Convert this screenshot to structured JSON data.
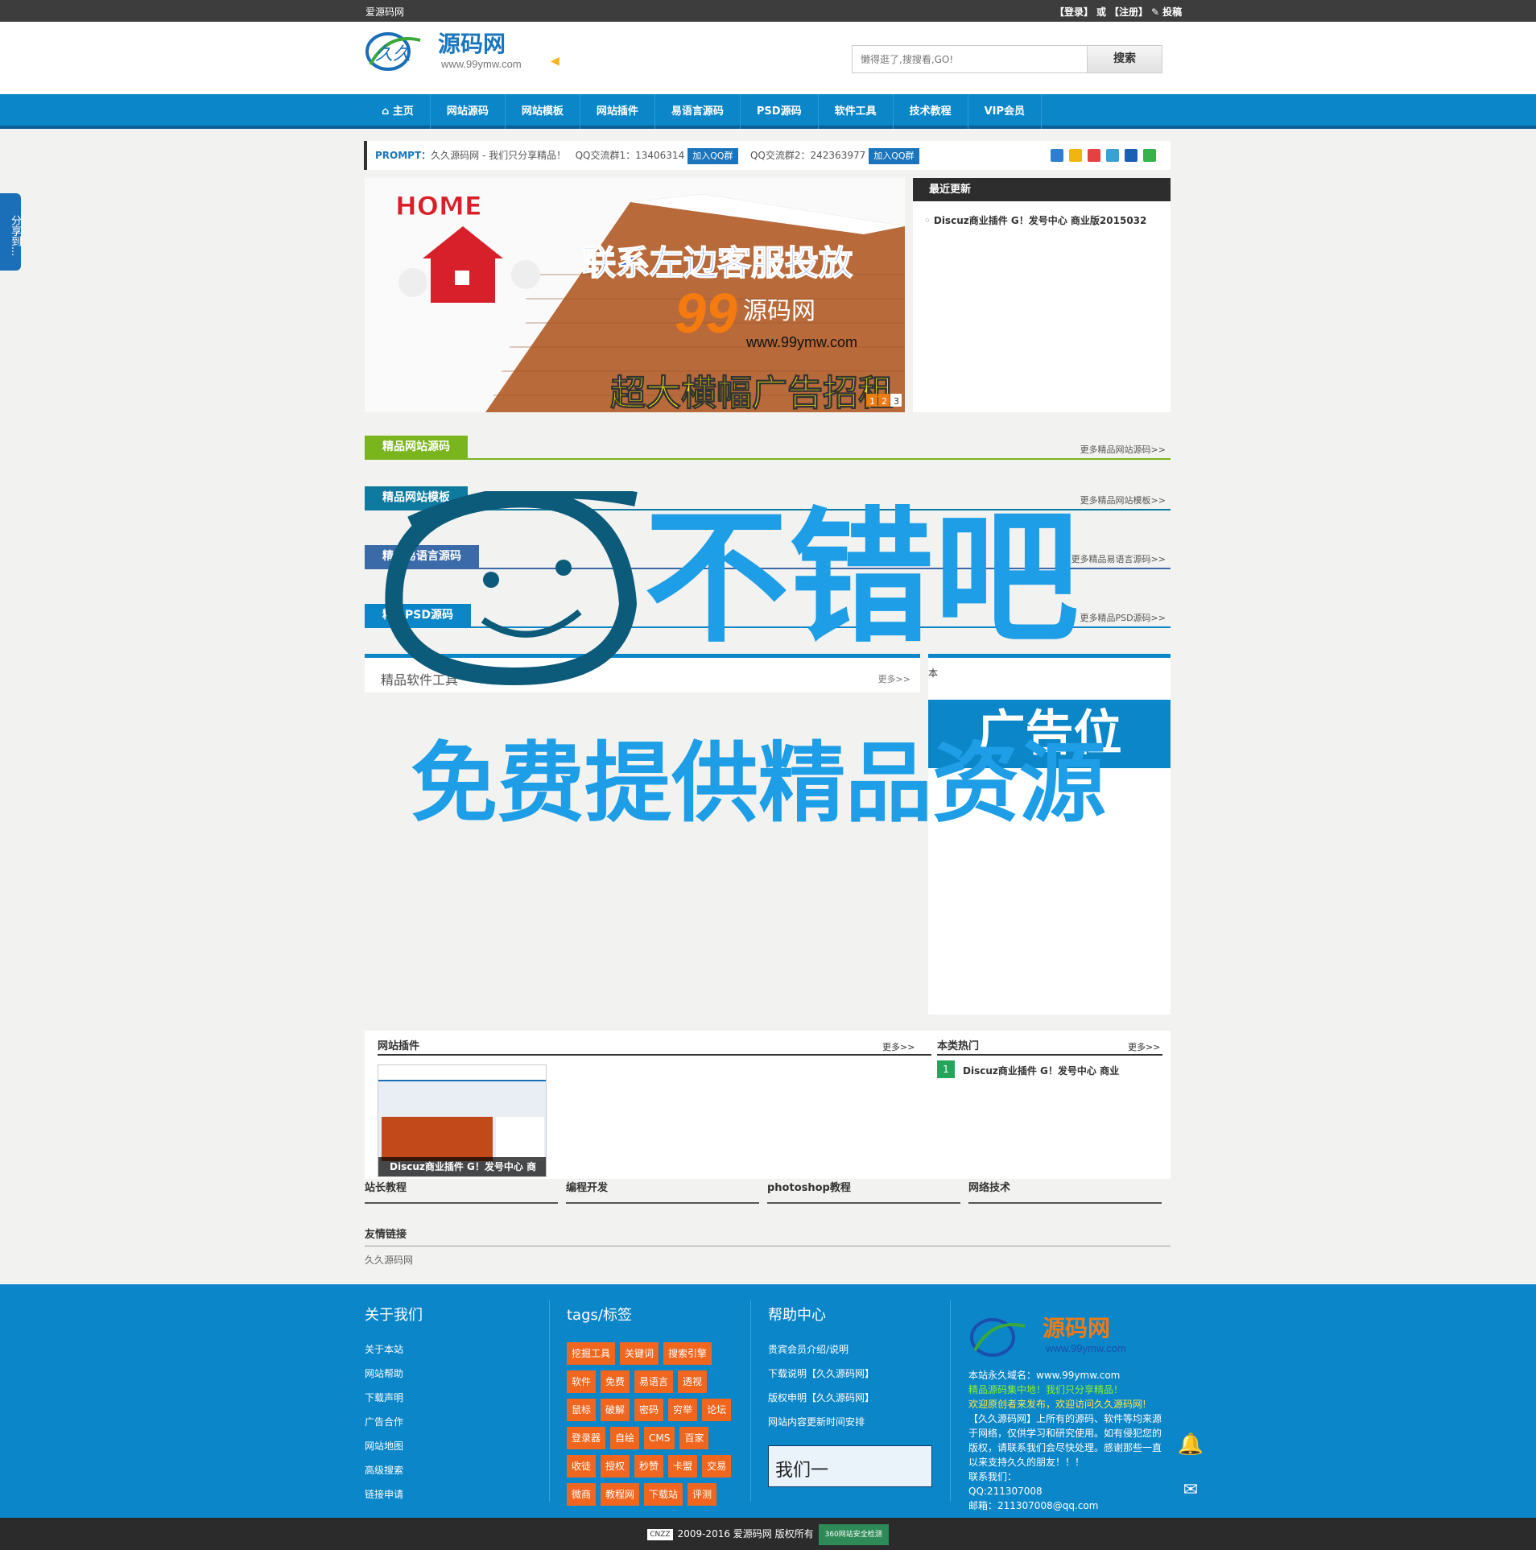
{
  "colors": {
    "brand_blue": "#0b86c8",
    "nav_dark": "#0a5f95",
    "top_bar": "#3d3d3d",
    "green": "#7ab51d",
    "teal": "#0e7aa0",
    "tag_orange": "#f0661e"
  },
  "topbar": {
    "site": "爱源码网",
    "login": "【登录】",
    "or": "或",
    "register": "【注册】",
    "submit": "投稿"
  },
  "logo": {
    "brand": "源码网",
    "prefix": "久久",
    "url": "www.99ymw.com"
  },
  "search": {
    "placeholder": "懒得逛了,搜搜看,GO!",
    "button": "搜索"
  },
  "nav": [
    "⌂ 主页",
    "网站源码",
    "网站模板",
    "网站插件",
    "易语言源码",
    "PSD源码",
    "软件工具",
    "技术教程",
    "VIP会员"
  ],
  "prompt": {
    "label": "PROMPT：",
    "text": "久久源码网 - 我们只分享精品！",
    "qq1_label": "QQ交流群1：",
    "qq1": "13406314",
    "qq2_label": "QQ交流群2：",
    "qq2": "242363977",
    "join": "加入QQ群"
  },
  "side_share": "分享到...",
  "banner": {
    "home": "HOME",
    "line1": "联系左边客服投放",
    "num": "99",
    "brand": "源码网",
    "url": "www.99ymw.com",
    "line2": "超大横幅广告招租",
    "pages": [
      "1",
      "2",
      "3"
    ]
  },
  "recent": {
    "title": "最近更新",
    "items": [
      "Discuz商业插件 G！发号中心 商业版2015032"
    ]
  },
  "sections": [
    {
      "title": "精品网站源码",
      "more": "更多精品网站源码>>"
    },
    {
      "title": "精品网站模板",
      "more": "更多精品网站模板>>"
    },
    {
      "title": "精品易语言源码",
      "more": "更多精品易语言源码>>"
    },
    {
      "title": "精品PSD源码",
      "more": "更多精品PSD源码>>"
    }
  ],
  "software": {
    "title": "精品软件工具",
    "more": "更多>>"
  },
  "adpanel": {
    "title": "本",
    "ad": "广告位"
  },
  "plugins": {
    "title": "网站插件",
    "more": "更多>>",
    "thumb_caption": "Discuz商业插件 G！发号中心 商"
  },
  "hot": {
    "title": "本类热门",
    "more": "更多>>",
    "items": [
      {
        "rank": "1",
        "text": "Discuz商业插件 G！发号中心 商业"
      }
    ]
  },
  "categories": [
    "站长教程",
    "编程开发",
    "photoshop教程",
    "网络技术"
  ],
  "friend": {
    "title": "友情链接",
    "links": [
      "久久源码网"
    ]
  },
  "footer": {
    "about": {
      "title": "关于我们",
      "items": [
        "关于本站",
        "网站帮助",
        "下载声明",
        "广告合作",
        "网站地图",
        "高级搜索",
        "链接申请"
      ]
    },
    "tags": {
      "title": "tags/标签",
      "items": [
        "挖掘工具",
        "关键词",
        "搜索引擎",
        "软件",
        "免费",
        "易语言",
        "透视",
        "鼠标",
        "破解",
        "密码",
        "穷举",
        "论坛",
        "登录器",
        "自绘",
        "CMS",
        "百家",
        "收徒",
        "授权",
        "秒赞",
        "卡盟",
        "交易",
        "微商",
        "教程网",
        "下载站",
        "评测"
      ]
    },
    "help": {
      "title": "帮助中心",
      "items": [
        "贵宾会员介绍/说明",
        "下载说明【久久源码网】",
        "版权申明【久久源码网】",
        "网站内容更新时间安排"
      ],
      "box": "我们一"
    },
    "info": {
      "domain": "本站永久域名：www.99ymw.com",
      "slogan1": "精品源码集中地！我们只分享精品！",
      "slogan2": "欢迎原创者来发布，欢迎访问久久源码网!",
      "desc": "【久久源码网】上所有的源码、软件等均来源于网络，仅供学习和研究使用。如有侵犯您的版权，请联系我们会尽快处理。感谢那些一直以来支持久久的朋友！！！",
      "contact": "联系我们：",
      "qq": "QQ:211307008",
      "email": "邮箱：211307008@qq.com"
    }
  },
  "bottom": {
    "copyright": "2009-2016 爱源码网 版权所有",
    "cnzz": "CNZZ",
    "safe": "360网站安全检测"
  },
  "watermark": {
    "main": "不错吧",
    "sub": "免费提供精品资源"
  }
}
